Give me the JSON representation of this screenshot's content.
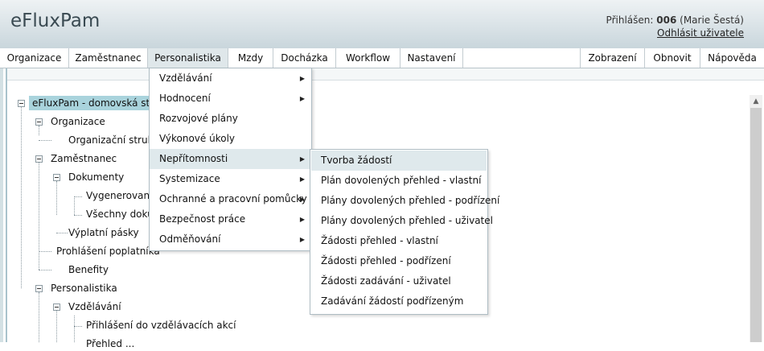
{
  "header": {
    "app_title": "eFluxPam",
    "login_prefix": "Přihlášen:",
    "user_code": "006",
    "user_name": "(Marie Šestá)",
    "logout_label": "Odhlásit uživatele"
  },
  "menubar": {
    "left": [
      "Organizace",
      "Zaměstnanec",
      "Personalistika",
      "Mzdy",
      "Docházka",
      "Workflow",
      "Nastavení"
    ],
    "right": [
      "Zobrazení",
      "Obnovit",
      "Nápověda"
    ],
    "active": "Personalistika"
  },
  "tree": {
    "root": "eFluxPam - domovská strán",
    "n_organizace": "Organizace",
    "n_org_struktura": "Organizační struktu",
    "n_zamestnanec": "Zaměstnanec",
    "n_dokumenty": "Dokumenty",
    "n_vygenerovane": "Vygenerované",
    "n_vsechny": "Všechny dokur",
    "n_vyplatni": "Výplatní pásky",
    "n_prohlaseni": "Prohlášení poplatníka",
    "n_benefity": "Benefity",
    "n_personalistika": "Personalistika",
    "n_vzdelavani": "Vzdělávání",
    "n_prihlaseni": "Přihlášení do vzdělávacích akcí",
    "n_cut": "Přehled ..."
  },
  "menu_personalistika": [
    {
      "label": "Vzdělávání",
      "submenu": true
    },
    {
      "label": "Hodnocení",
      "submenu": true
    },
    {
      "label": "Rozvojové plány",
      "submenu": false
    },
    {
      "label": "Výkonové úkoly",
      "submenu": false
    },
    {
      "label": "Nepřítomnosti",
      "submenu": true
    },
    {
      "label": "Systemizace",
      "submenu": true
    },
    {
      "label": "Ochranné a pracovní pomůcky",
      "submenu": true
    },
    {
      "label": "Bezpečnost práce",
      "submenu": true
    },
    {
      "label": "Odměňování",
      "submenu": true
    }
  ],
  "menu_nepritomnosti": [
    "Tvorba žádostí",
    "Plán dovolených přehled - vlastní",
    "Plány dovolených přehled - podřízení",
    "Plány dovolených přehled - uživatel",
    "Žádosti přehled - vlastní",
    "Žádosti přehled - podřízení",
    "Žádosti zadávání - uživatel",
    "Zadávání žádostí podřízeným"
  ],
  "colors": {
    "header_top": "#eef2f4",
    "header_bottom": "#c9d6dc",
    "root_highlight": "#a9d3dc",
    "menu_highlight": "#dfe9ec"
  },
  "icons": {
    "submenu_arrow": "triangle-right",
    "tree_toggle": "minus-box",
    "scroll_up": "triangle-up"
  }
}
